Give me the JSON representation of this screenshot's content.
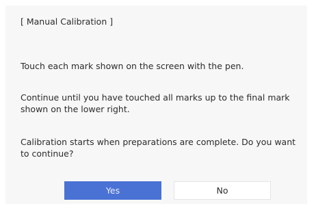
{
  "dialog": {
    "title": "[ Manual Calibration ]",
    "paragraphs": [
      "Touch each mark shown on the screen with the pen.",
      "Continue until you have touched all marks up to the final mark shown on the lower right.",
      "Calibration starts when preparations are complete. Do you want to continue?"
    ],
    "buttons": {
      "yes_label": "Yes",
      "no_label": "No"
    }
  },
  "colors": {
    "dialog_background": "#f7f7f7",
    "primary_button": "#4a72d4",
    "text": "#2b2b2b"
  }
}
